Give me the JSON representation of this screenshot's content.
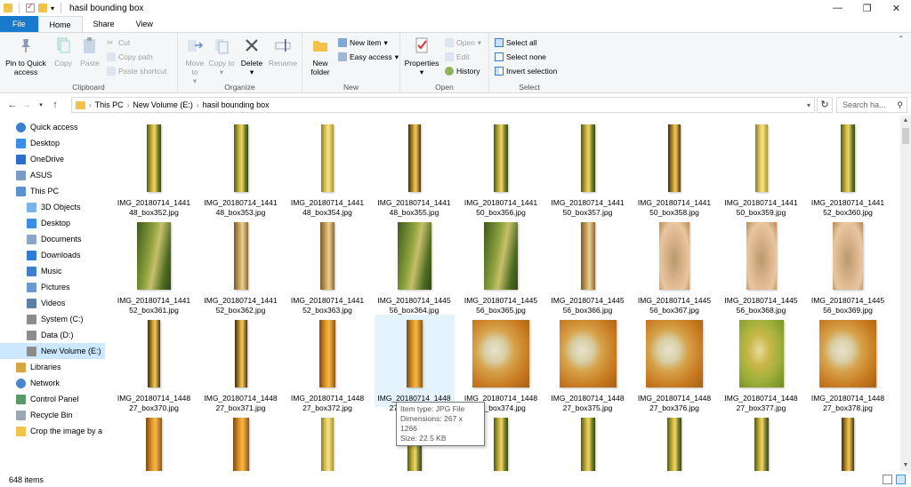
{
  "window": {
    "title": "hasil bounding box",
    "controls": {
      "minimize": "—",
      "maximize": "❐",
      "close": "✕"
    }
  },
  "tabs": [
    {
      "label": "File"
    },
    {
      "label": "Home"
    },
    {
      "label": "Share"
    },
    {
      "label": "View"
    }
  ],
  "ribbon": {
    "clipboard": {
      "label": "Clipboard",
      "pin": "Pin to Quick access",
      "copy": "Copy",
      "paste": "Paste",
      "cut": "Cut",
      "copy_path": "Copy path",
      "paste_shortcut": "Paste shortcut"
    },
    "organize": {
      "label": "Organize",
      "move_to": "Move to",
      "copy_to": "Copy to",
      "delete": "Delete",
      "rename": "Rename"
    },
    "new": {
      "label": "New",
      "new_folder": "New folder",
      "new_item": "New item",
      "easy_access": "Easy access"
    },
    "open": {
      "label": "Open",
      "properties": "Properties",
      "open": "Open",
      "edit": "Edit",
      "history": "History"
    },
    "select": {
      "label": "Select",
      "select_all": "Select all",
      "select_none": "Select none",
      "invert": "Invert selection"
    }
  },
  "address": {
    "crumbs": [
      "This PC",
      "New Volume (E:)",
      "hasil bounding box"
    ],
    "search_placeholder": "Search ha..."
  },
  "sidebar": [
    {
      "label": "Quick access",
      "icon": "star-icon",
      "indent": 0
    },
    {
      "label": "Desktop",
      "icon": "desktop-icon",
      "indent": 0
    },
    {
      "label": "OneDrive",
      "icon": "cloud-icon",
      "indent": 1
    },
    {
      "label": "ASUS",
      "icon": "user-icon",
      "indent": 1
    },
    {
      "label": "This PC",
      "icon": "computer-icon",
      "indent": 1
    },
    {
      "label": "3D Objects",
      "icon": "cube-icon",
      "indent": 2
    },
    {
      "label": "Desktop",
      "icon": "desktop-icon",
      "indent": 2
    },
    {
      "label": "Documents",
      "icon": "document-icon",
      "indent": 2
    },
    {
      "label": "Downloads",
      "icon": "download-icon",
      "indent": 2
    },
    {
      "label": "Music",
      "icon": "music-icon",
      "indent": 2
    },
    {
      "label": "Pictures",
      "icon": "picture-icon",
      "indent": 2
    },
    {
      "label": "Videos",
      "icon": "video-icon",
      "indent": 2
    },
    {
      "label": "System (C:)",
      "icon": "drive-icon",
      "indent": 2
    },
    {
      "label": "Data (D:)",
      "icon": "drive-icon",
      "indent": 2
    },
    {
      "label": "New Volume (E:)",
      "icon": "drive-icon",
      "indent": 2,
      "selected": true
    },
    {
      "label": "Libraries",
      "icon": "library-icon",
      "indent": 1
    },
    {
      "label": "Network",
      "icon": "network-icon",
      "indent": 1
    },
    {
      "label": "Control Panel",
      "icon": "control-panel-icon",
      "indent": 1
    },
    {
      "label": "Recycle Bin",
      "icon": "recycle-bin-icon",
      "indent": 1
    },
    {
      "label": "Crop the image by a",
      "icon": "folder-icon",
      "indent": 1
    }
  ],
  "files": [
    {
      "line1": "IMG_20180714_1441",
      "line2": "48_box352.jpg",
      "kind": "green-yellow"
    },
    {
      "line1": "IMG_20180714_1441",
      "line2": "48_box353.jpg",
      "kind": "green-yellow"
    },
    {
      "line1": "IMG_20180714_1441",
      "line2": "48_box354.jpg",
      "kind": "yellow"
    },
    {
      "line1": "IMG_20180714_1441",
      "line2": "48_box355.jpg",
      "kind": "yellow-dark"
    },
    {
      "line1": "IMG_20180714_1441",
      "line2": "50_box356.jpg",
      "kind": "green-yellow"
    },
    {
      "line1": "IMG_20180714_1441",
      "line2": "50_box357.jpg",
      "kind": "green-yellow"
    },
    {
      "line1": "IMG_20180714_1441",
      "line2": "50_box358.jpg",
      "kind": "yellow-dark"
    },
    {
      "line1": "IMG_20180714_1441",
      "line2": "50_box359.jpg",
      "kind": "yellow"
    },
    {
      "line1": "IMG_20180714_1441",
      "line2": "52_box360.jpg",
      "kind": "green-yellow"
    },
    {
      "line1": "IMG_20180714_1441",
      "line2": "52_box361.jpg",
      "kind": "green"
    },
    {
      "line1": "IMG_20180714_1441",
      "line2": "52_box362.jpg",
      "kind": "tan"
    },
    {
      "line1": "IMG_20180714_1441",
      "line2": "52_box363.jpg",
      "kind": "tan"
    },
    {
      "line1": "IMG_20180714_1445",
      "line2": "56_box364.jpg",
      "kind": "green"
    },
    {
      "line1": "IMG_20180714_1445",
      "line2": "56_box365.jpg",
      "kind": "green"
    },
    {
      "line1": "IMG_20180714_1445",
      "line2": "56_box366.jpg",
      "kind": "tan"
    },
    {
      "line1": "IMG_20180714_1445",
      "line2": "56_box367.jpg",
      "kind": "pink-tan"
    },
    {
      "line1": "IMG_20180714_1445",
      "line2": "56_box368.jpg",
      "kind": "pink-tan"
    },
    {
      "line1": "IMG_20180714_1445",
      "line2": "56_box369.jpg",
      "kind": "pink-tan"
    },
    {
      "line1": "IMG_20180714_1448",
      "line2": "27_box370.jpg",
      "kind": "yellow-dark"
    },
    {
      "line1": "IMG_20180714_1448",
      "line2": "27_box371.jpg",
      "kind": "yellow-dark"
    },
    {
      "line1": "IMG_20180714_1448",
      "line2": "27_box372.jpg",
      "kind": "orange"
    },
    {
      "line1": "IMG_20180714_1448",
      "line2": "27_box373.jpg",
      "kind": "orange"
    },
    {
      "line1": "IMG_20180714_1448",
      "line2": "27_box374.jpg",
      "kind": "lesion"
    },
    {
      "line1": "IMG_20180714_1448",
      "line2": "27_box375.jpg",
      "kind": "lesion"
    },
    {
      "line1": "IMG_20180714_1448",
      "line2": "27_box376.jpg",
      "kind": "lesion"
    },
    {
      "line1": "IMG_20180714_1448",
      "line2": "27_box377.jpg",
      "kind": "lesion-green"
    },
    {
      "line1": "IMG_20180714_1448",
      "line2": "27_box378.jpg",
      "kind": "lesion"
    },
    {
      "line1": "",
      "line2": "",
      "kind": "orange"
    },
    {
      "line1": "",
      "line2": "",
      "kind": "orange"
    },
    {
      "line1": "",
      "line2": "",
      "kind": "yellow"
    },
    {
      "line1": "",
      "line2": "",
      "kind": "green-yellow"
    },
    {
      "line1": "",
      "line2": "",
      "kind": "green-yellow"
    },
    {
      "line1": "",
      "line2": "",
      "kind": "green-yellow"
    },
    {
      "line1": "",
      "line2": "",
      "kind": "green-yellow"
    },
    {
      "line1": "",
      "line2": "",
      "kind": "green-yellow"
    },
    {
      "line1": "",
      "line2": "",
      "kind": "yellow-dark"
    }
  ],
  "hovered_index": 21,
  "tooltip": {
    "type": "Item type: JPG File",
    "dimensions": "Dimensions: 267 x 1266",
    "size": "Size: 22.5 KB"
  },
  "status": {
    "items": "648 items"
  },
  "colors": {
    "accent": "#1979ca",
    "selection": "#cce8ff",
    "hover": "#e5f3ff"
  }
}
